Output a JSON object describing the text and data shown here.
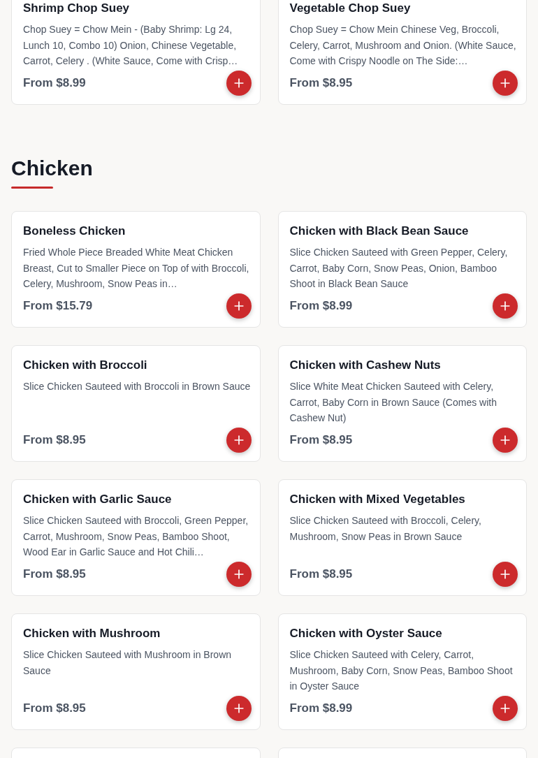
{
  "previous_items": [
    {
      "name": "Shrimp Chop Suey",
      "description": "Chop Suey = Chow Mein - (Baby Shrimp: Lg 24, Lunch 10, Combo 10) Onion, Chinese Vegetable, Carrot, Celery . (White Sauce, Come with Crisp…",
      "price": "From $8.99"
    },
    {
      "name": "Vegetable Chop Suey",
      "description": "Chop Suey = Chow Mein Chinese Veg, Broccoli, Celery, Carrot, Mushroom and Onion. (White Sauce, Come with Crispy Noodle on The Side:…",
      "price": "From $8.95"
    }
  ],
  "section": {
    "title": "Chicken",
    "items": [
      {
        "name": "Boneless Chicken",
        "description": "Fried Whole Piece Breaded White Meat Chicken Breast, Cut to Smaller Piece on Top of with Broccoli, Celery, Mushroom, Snow Peas in…",
        "price": "From $15.79"
      },
      {
        "name": "Chicken with Black Bean Sauce",
        "description": "Slice Chicken Sauteed with Green Pepper, Celery, Carrot, Baby Corn, Snow Peas, Onion, Bamboo Shoot in Black Bean Sauce",
        "price": "From $8.99"
      },
      {
        "name": "Chicken with Broccoli",
        "description": "Slice Chicken Sauteed with Broccoli in Brown Sauce",
        "price": "From $8.95"
      },
      {
        "name": "Chicken with Cashew Nuts",
        "description": "Slice White Meat Chicken Sauteed with Celery, Carrot, Baby Corn in Brown Sauce (Comes with Cashew Nut)",
        "price": "From $8.95"
      },
      {
        "name": "Chicken with Garlic Sauce",
        "description": "Slice Chicken Sauteed with Broccoli, Green Pepper, Carrot, Mushroom, Snow Peas, Bamboo Shoot, Wood Ear in Garlic Sauce and Hot Chili…",
        "price": "From $8.95"
      },
      {
        "name": "Chicken with Mixed Vegetables",
        "description": "Slice Chicken Sauteed with Broccoli, Celery, Mushroom, Snow Peas in Brown Sauce",
        "price": "From $8.95"
      },
      {
        "name": "Chicken with Mushroom",
        "description": "Slice Chicken Sauteed with Mushroom in Brown Sauce",
        "price": "From $8.95"
      },
      {
        "name": "Chicken with Oyster Sauce",
        "description": "Slice Chicken Sauteed with Celery, Carrot, Mushroom, Baby Corn, Snow Peas, Bamboo Shoot in Oyster Sauce",
        "price": "From $8.99"
      }
    ]
  }
}
